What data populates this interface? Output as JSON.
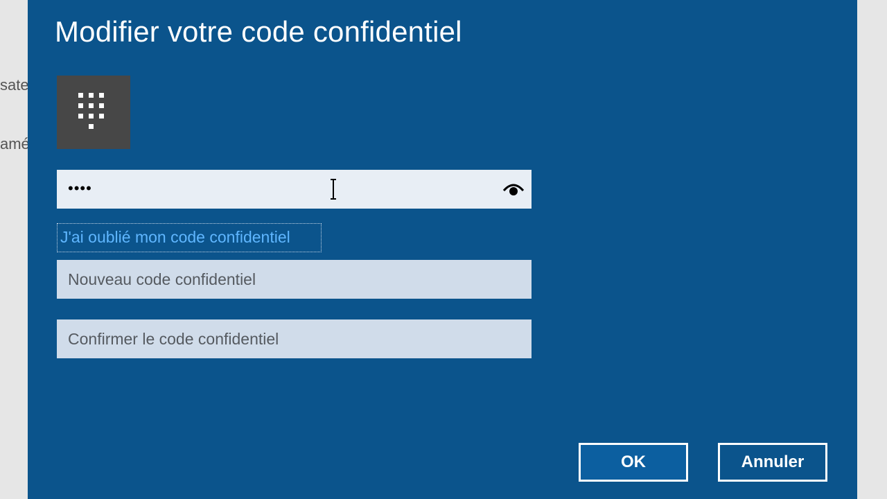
{
  "background": {
    "text_fragment_1": "sate",
    "text_fragment_2": "amé"
  },
  "dialog": {
    "title": "Modifier votre code confidentiel",
    "pin_icon": "keypad-icon",
    "current_pin": {
      "masked_value": "••••",
      "reveal_icon": "eye-icon"
    },
    "forgot_link": "J'ai oublié mon code confidentiel",
    "new_pin": {
      "placeholder": "Nouveau code confidentiel",
      "value": ""
    },
    "confirm_pin": {
      "placeholder": "Confirmer le code confidentiel",
      "value": ""
    },
    "buttons": {
      "ok": "OK",
      "cancel": "Annuler"
    }
  },
  "colors": {
    "dialog_background": "#0b548c",
    "link": "#5fb6ff",
    "input_background": "#d0dcea",
    "tile": "#474747"
  }
}
